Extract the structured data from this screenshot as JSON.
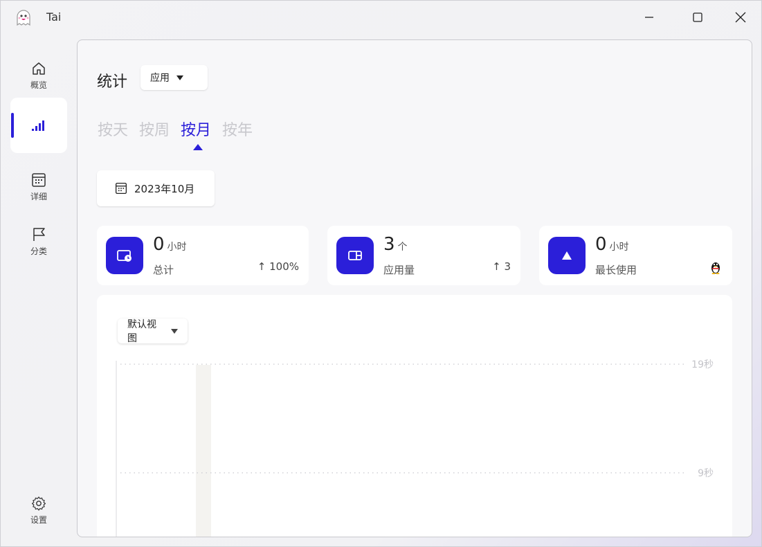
{
  "app": {
    "title": "Tai"
  },
  "sidebar": {
    "items": [
      {
        "label": "概览",
        "icon": "home-icon"
      },
      {
        "label": "",
        "icon": "bar-chart-icon"
      },
      {
        "label": "详细",
        "icon": "calendar-icon"
      },
      {
        "label": "分类",
        "icon": "flag-icon"
      },
      {
        "label": "设置",
        "icon": "gear-icon"
      }
    ]
  },
  "header": {
    "title": "统计",
    "type_dropdown": "应用"
  },
  "tabs": [
    {
      "label": "按天"
    },
    {
      "label": "按周"
    },
    {
      "label": "按月"
    },
    {
      "label": "按年"
    }
  ],
  "date": {
    "label": "2023年10月"
  },
  "cards": [
    {
      "value": "0",
      "unit": "小时",
      "label": "总计",
      "trend": "↑ 100%",
      "icon": "clock-window-icon"
    },
    {
      "value": "3",
      "unit": "个",
      "label": "应用量",
      "trend": "↑ 3",
      "icon": "app-window-icon"
    },
    {
      "value": "0",
      "unit": "小时",
      "label": "最长使用",
      "trend": "",
      "icon": "triangle-icon",
      "app_icon": "qq-penguin-icon"
    }
  ],
  "view_dropdown": "默认视图",
  "colors": {
    "accent": "#2b1fd9",
    "muted_tab": "#c8c8cd"
  },
  "chart_data": {
    "type": "bar",
    "y_ticks": [
      "19秒",
      "9秒"
    ],
    "y_tick_values": [
      19,
      9
    ],
    "ylim": [
      0,
      19
    ],
    "grid": true
  }
}
